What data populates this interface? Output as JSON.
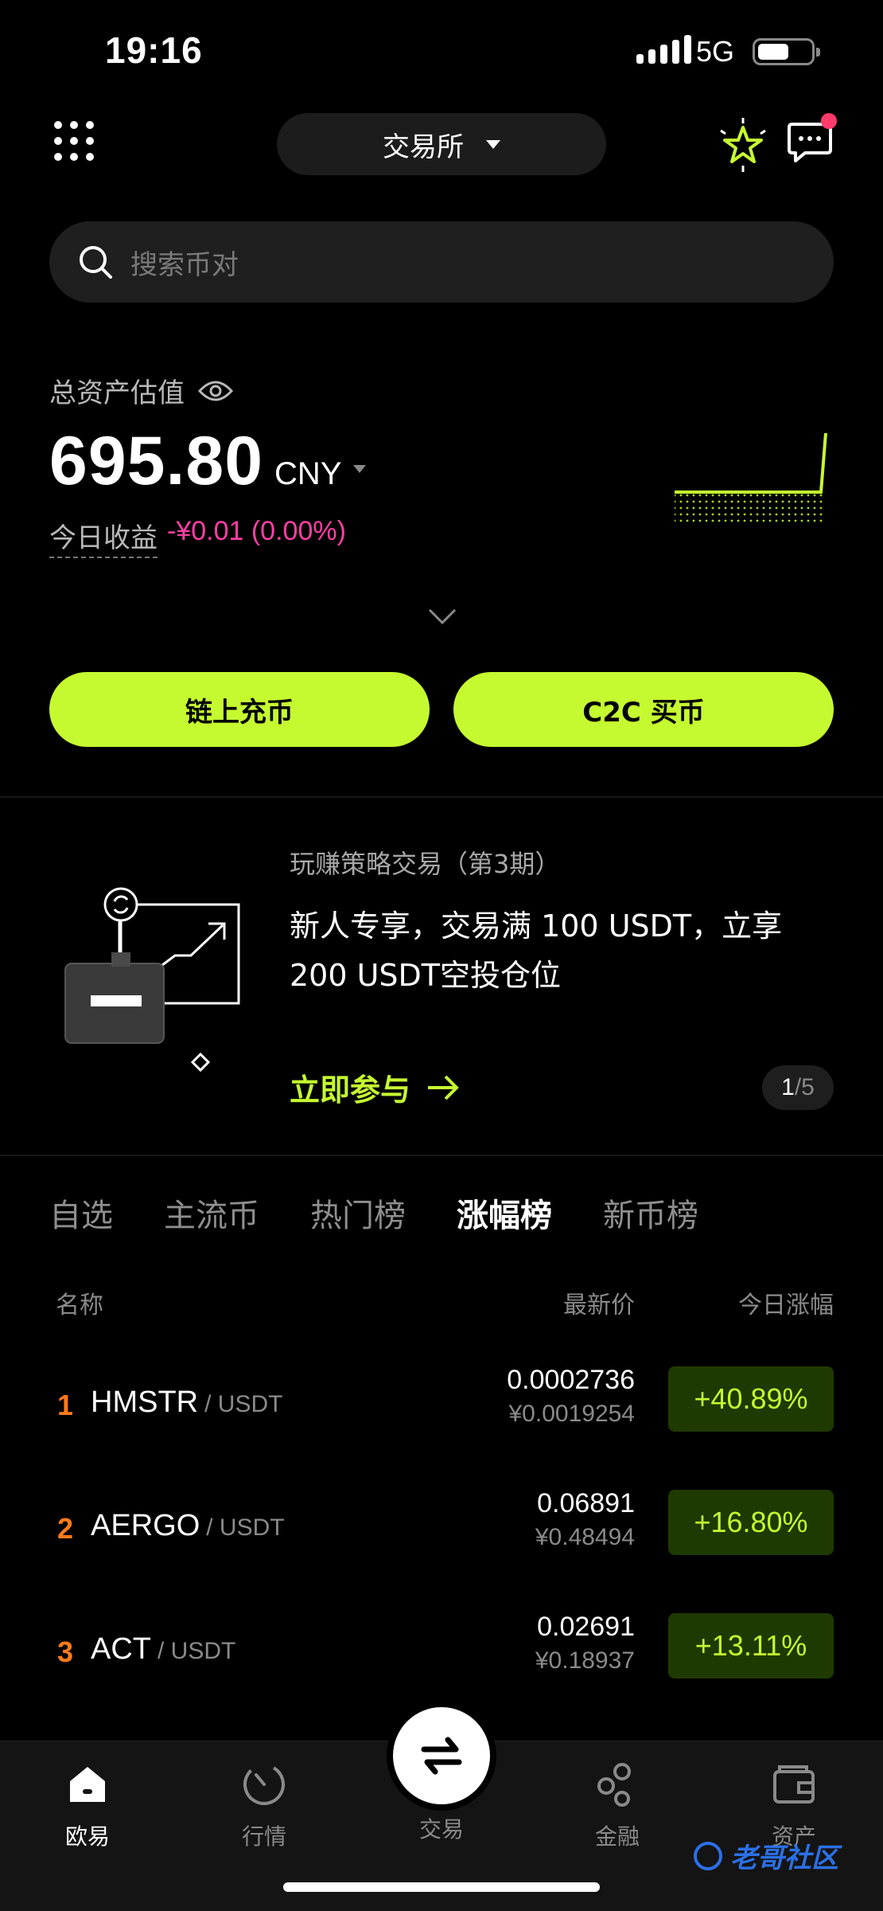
{
  "status_bar": {
    "time": "19:16",
    "network": "5G"
  },
  "header": {
    "exchange_label": "交易所"
  },
  "search": {
    "placeholder": "搜索币对"
  },
  "assets": {
    "label": "总资产估值",
    "value": "695.80",
    "currency": "CNY",
    "pnl_label": "今日收益",
    "pnl_value": "-¥0.01 (0.00%)"
  },
  "actions": {
    "onchain_deposit": "链上充币",
    "c2c_buy": "C2C 买币"
  },
  "banner": {
    "subtitle": "玩赚策略交易（第3期）",
    "title": "新人专享，交易满 100 USDT，立享 200 USDT空投仓位",
    "cta": "立即参与",
    "page_current": "1",
    "page_total": "/5"
  },
  "tabs": [
    {
      "label": "自选",
      "active": false
    },
    {
      "label": "主流币",
      "active": false
    },
    {
      "label": "热门榜",
      "active": false
    },
    {
      "label": "涨幅榜",
      "active": true
    },
    {
      "label": "新币榜",
      "active": false
    }
  ],
  "columns": {
    "name": "名称",
    "price": "最新价",
    "change": "今日涨幅"
  },
  "rows": [
    {
      "rank": "1",
      "base": "HMSTR",
      "quote": "/ USDT",
      "price": "0.0002736",
      "price_cny": "¥0.0019254",
      "change": "+40.89%"
    },
    {
      "rank": "2",
      "base": "AERGO",
      "quote": "/ USDT",
      "price": "0.06891",
      "price_cny": "¥0.48494",
      "change": "+16.80%"
    },
    {
      "rank": "3",
      "base": "ACT",
      "quote": "/ USDT",
      "price": "0.02691",
      "price_cny": "¥0.18937",
      "change": "+13.11%"
    }
  ],
  "nav": {
    "home": "欧易",
    "market": "行情",
    "trade": "交易",
    "finance": "金融",
    "assets": "资产"
  },
  "watermark": "老哥社区",
  "colors": {
    "accent": "#c5fa30",
    "loss": "#ff3fa6",
    "rank": "#ff7a1a",
    "badge_bg": "#1f3a00"
  }
}
